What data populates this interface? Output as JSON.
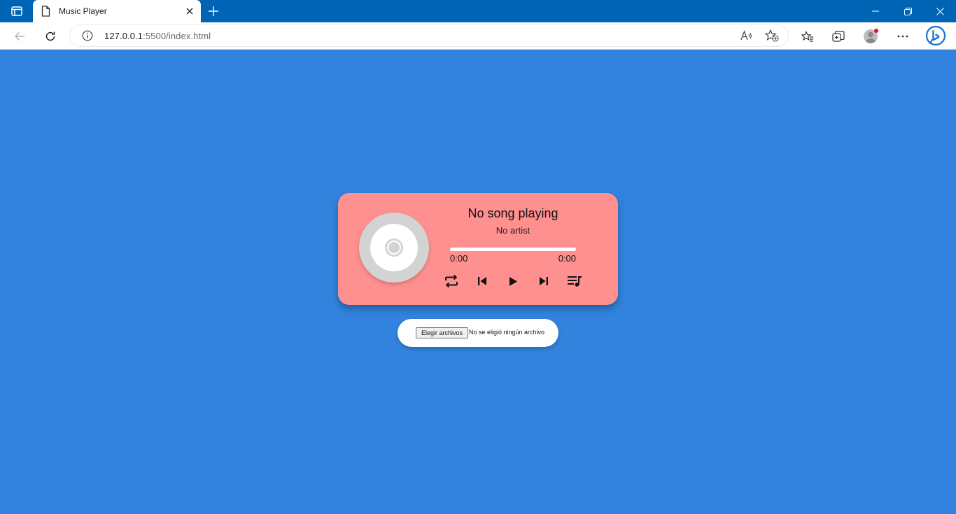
{
  "browser": {
    "tab_title": "Music Player",
    "url_host": "127.0.0.1",
    "url_path": ":5500/index.html"
  },
  "colors": {
    "page_background": "#3183de",
    "player_background": "#ff9090",
    "browser_titlebar": "#0064b5"
  },
  "player": {
    "song_title": "No song playing",
    "artist": "No artist",
    "current_time": "0:00",
    "duration": "0:00",
    "progress_fraction": 0,
    "controls": [
      "repeat-icon",
      "previous-icon",
      "play-icon",
      "next-icon",
      "playlist-icon"
    ]
  },
  "file_input": {
    "button_label": "Elegir archivos",
    "status": "No se eligió ningún archivo"
  }
}
